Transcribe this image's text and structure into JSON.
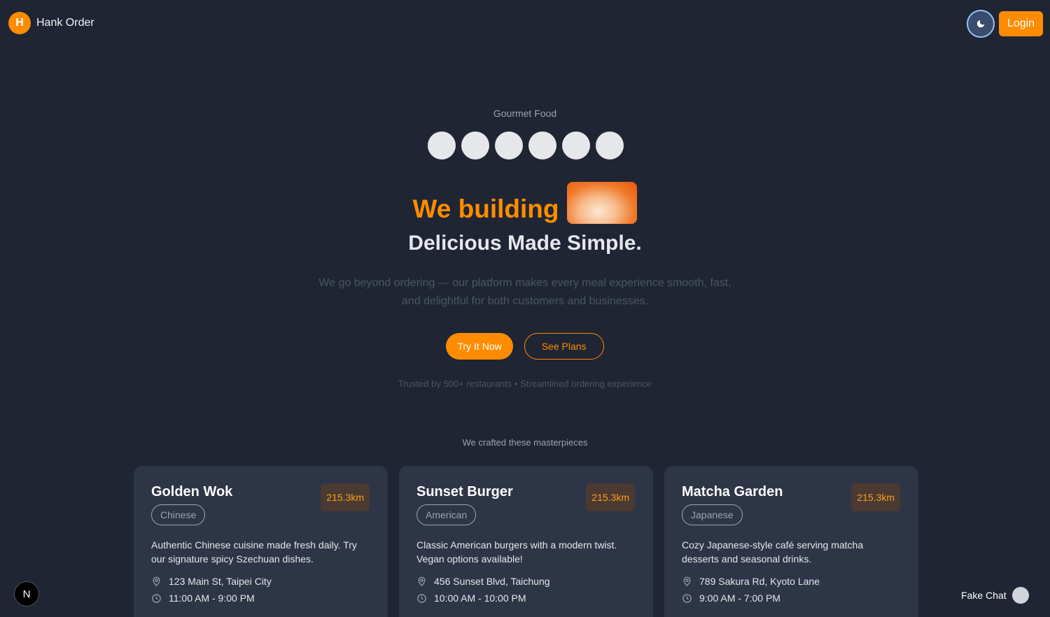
{
  "header": {
    "logo_letter": "H",
    "brand_name": "Hank Order",
    "theme_icon": "moon-icon",
    "login_label": "Login"
  },
  "hero": {
    "eyebrow": "Gourmet Food",
    "headline": "We building",
    "subheadline": "Delicious Made Simple.",
    "description": "We go beyond ordering — our platform makes every meal experience smooth, fast, and delightful for both customers and businesses.",
    "primary_cta": "Try It Now",
    "secondary_cta": "See Plans",
    "trust_line": "Trusted by 500+ restaurants • Streamlined ordering experience"
  },
  "showcase": {
    "label": "We crafted these masterpieces",
    "cards": [
      {
        "title": "Golden Wok",
        "distance": "215.3km",
        "tag": "Chinese",
        "description": "Authentic Chinese cuisine made fresh daily. Try our signature spicy Szechuan dishes.",
        "address": "123 Main St, Taipei City",
        "hours": "11:00 AM - 9:00 PM"
      },
      {
        "title": "Sunset Burger",
        "distance": "215.3km",
        "tag": "American",
        "description": "Classic American burgers with a modern twist. Vegan options available!",
        "address": "456 Sunset Blvd, Taichung",
        "hours": "10:00 AM - 10:00 PM"
      },
      {
        "title": "Matcha Garden",
        "distance": "215.3km",
        "tag": "Japanese",
        "description": "Cozy Japanese-style café serving matcha desserts and seasonal drinks.",
        "address": "789 Sakura Rd, Kyoto Lane",
        "hours": "9:00 AM - 7:00 PM"
      }
    ]
  },
  "footer": {
    "dev_badge": "N",
    "chat_label": "Fake Chat"
  },
  "colors": {
    "background": "#1f2533",
    "accent": "#ff8c00",
    "card": "#2e3546"
  }
}
